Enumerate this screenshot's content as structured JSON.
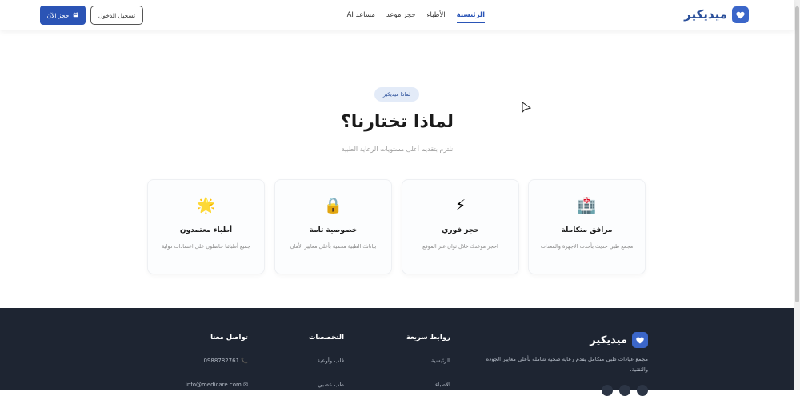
{
  "header": {
    "brand": "ميديكير",
    "nav": [
      {
        "label": "الرئيسية",
        "active": true
      },
      {
        "label": "الأطباء",
        "active": false
      },
      {
        "label": "حجز موعد",
        "active": false
      },
      {
        "label": "مساعد AI",
        "active": false
      }
    ],
    "login_label": "تسجيل الدخول",
    "book_label": "احجز الآن"
  },
  "section": {
    "pill": "لماذا ميديكير",
    "title": "لماذا تختارنا؟",
    "subtitle": "نلتزم بتقديم أعلى مستويات الرعاية الطبية",
    "cards": [
      {
        "icon": "hospital-icon",
        "glyph": "🏥",
        "title": "مرافق متكاملة",
        "desc": "مجمع طبي حديث بأحدث الأجهزة والمعدات"
      },
      {
        "icon": "lightning-icon",
        "glyph": "⚡",
        "title": "حجز فوري",
        "desc": "احجز موعدك خلال ثوان عبر الموقع"
      },
      {
        "icon": "lock-icon",
        "glyph": "🔒",
        "title": "خصوصية تامة",
        "desc": "بياناتك الطبية محمية بأعلى معايير الأمان"
      },
      {
        "icon": "star-icon",
        "glyph": "🌟",
        "title": "أطباء معتمدون",
        "desc": "جميع أطبائنا حاصلون على اعتمادات دولية"
      }
    ]
  },
  "footer": {
    "brand": "ميديكير",
    "description": "مجمع عيادات طبي متكامل يقدم رعاية صحية شاملة بأعلى معايير الجودة والتقنية.",
    "quick_links": {
      "title": "روابط سريعة",
      "items": [
        "الرئيسية",
        "الأطباء"
      ]
    },
    "specialties": {
      "title": "التخصصات",
      "items": [
        "قلب وأوعية",
        "طب عصبي"
      ]
    },
    "contact": {
      "title": "تواصل معنا",
      "phone": "0988782761",
      "email": "info@medicare.com"
    }
  },
  "colors": {
    "primary": "#2b54b5",
    "footer_bg": "#1e2532"
  }
}
